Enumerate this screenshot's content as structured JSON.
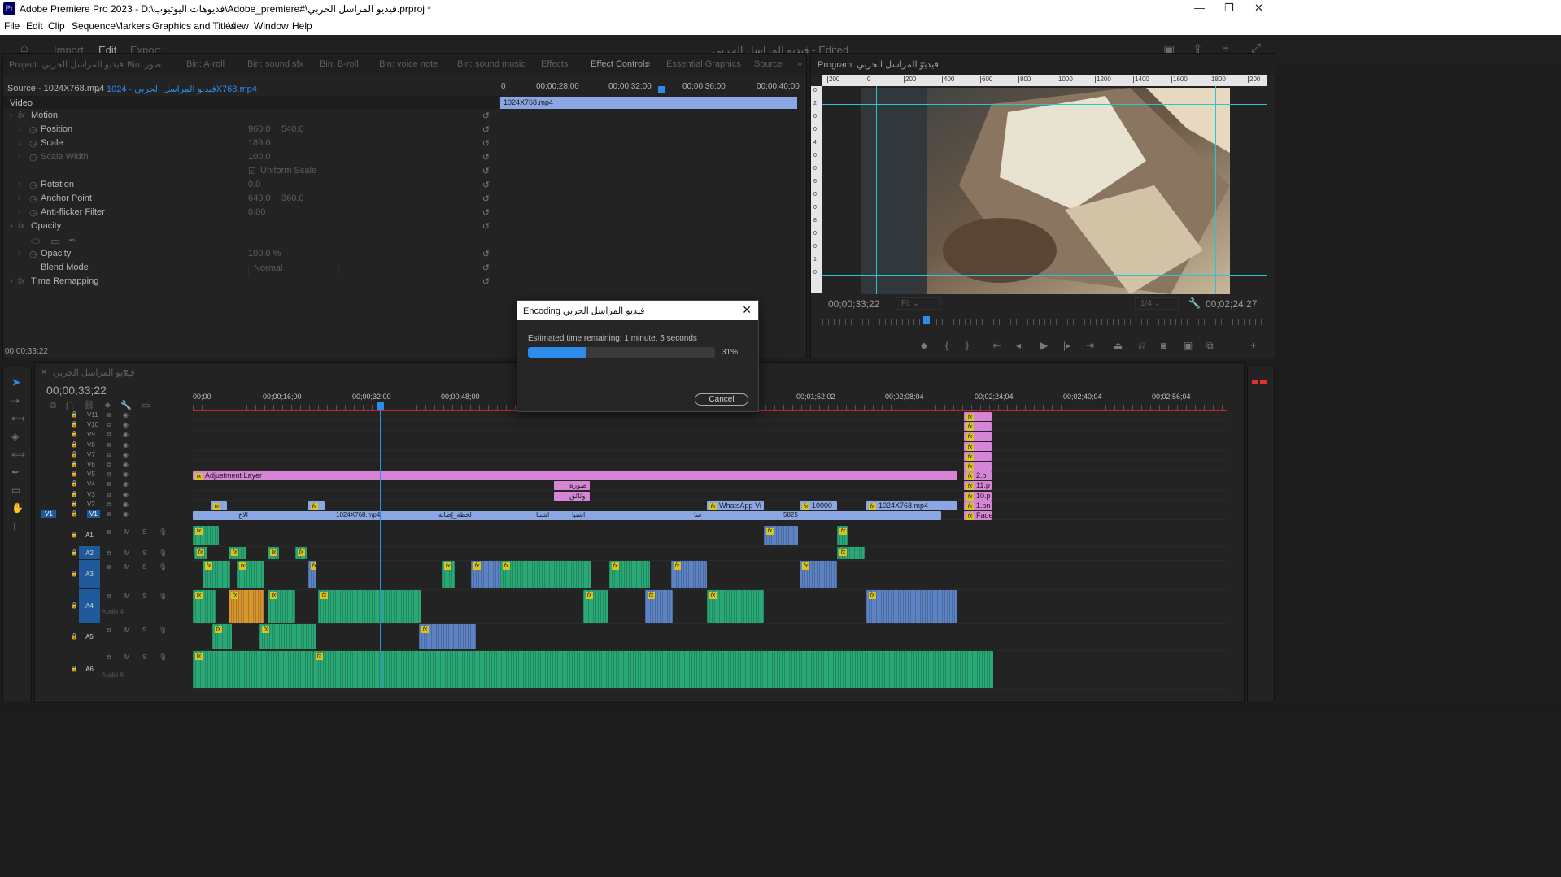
{
  "titlebar": {
    "title": "Adobe Premiere Pro 2023 - D:\\فديوهات اليوتيوب\\Adobe_premiere#\\فيديو المراسل الحربي.prproj *",
    "min": "—",
    "max": "❐",
    "close": "✕"
  },
  "menu": [
    "File",
    "Edit",
    "Clip",
    "Sequence",
    "Markers",
    "Graphics and Titles",
    "View",
    "Window",
    "Help"
  ],
  "workspace": {
    "tabs": [
      "Import",
      "Edit",
      "Export"
    ],
    "active": "Edit",
    "title": "فيديو المراسل الحربي - Edited"
  },
  "source_tabs": [
    "Project: فيديو المراسل الحربي",
    "Bin: صور",
    "Bin: A-roll",
    "Bin: sound sfx",
    "Bin: B-roll",
    "Bin: voice note",
    "Bin: sound music",
    "Effects",
    "Effect Controls",
    "Essential Graphics",
    "Source"
  ],
  "effect_controls": {
    "source": "Source - 1024X768.mp4",
    "sequence": "فيديو المراسل الحربي - 1024X768.mp4",
    "ruler": [
      "0",
      "00;00;28;00",
      "00;00;32;00",
      "00;00;36;00",
      "00;00;40;00"
    ],
    "clip_name": "1024X768.mp4",
    "video": "Video",
    "rows": [
      {
        "label": "Motion",
        "v1": "",
        "v2": "",
        "kind": "group"
      },
      {
        "label": "Position",
        "v1": "960.0",
        "v2": "540.0",
        "kind": "prop"
      },
      {
        "label": "Scale",
        "v1": "189.0",
        "v2": "",
        "kind": "prop"
      },
      {
        "label": "Scale Width",
        "v1": "100.0",
        "v2": "",
        "kind": "dim"
      },
      {
        "label": "",
        "v1": "Uniform Scale",
        "v2": "",
        "kind": "check"
      },
      {
        "label": "Rotation",
        "v1": "0.0",
        "v2": "",
        "kind": "prop"
      },
      {
        "label": "Anchor Point",
        "v1": "640.0",
        "v2": "360.0",
        "kind": "prop"
      },
      {
        "label": "Anti-flicker Filter",
        "v1": "0.00",
        "v2": "",
        "kind": "prop"
      },
      {
        "label": "Opacity",
        "v1": "",
        "v2": "",
        "kind": "group"
      },
      {
        "label": "",
        "v1": "",
        "v2": "",
        "kind": "masks"
      },
      {
        "label": "Opacity",
        "v1": "100.0 %",
        "v2": "",
        "kind": "prop"
      },
      {
        "label": "Blend Mode",
        "v1": "Normal",
        "v2": "",
        "kind": "select"
      },
      {
        "label": "Time Remapping",
        "v1": "",
        "v2": "",
        "kind": "group"
      }
    ],
    "timecode": "00;00;33;22"
  },
  "program": {
    "tab": "Program: فيديو المراسل الحربي",
    "ruler": [
      "200",
      "0",
      "200",
      "400",
      "600",
      "800",
      "1000",
      "1200",
      "1400",
      "1600",
      "1800",
      "200"
    ],
    "vruler": [
      "0",
      "2",
      "0",
      "0",
      "4",
      "0",
      "0",
      "6",
      "0",
      "0",
      "8",
      "0",
      "0",
      "1",
      "0"
    ],
    "timecode": "00;00;33;22",
    "fit": "Fit",
    "quality": "1/4",
    "duration": "00;02;24;27"
  },
  "timeline": {
    "tab": "فيديو المراسل الحربي",
    "timecode": "00;00;33;22",
    "ruler": [
      "00;00",
      "00;00;16;00",
      "00;00;32;00",
      "00;00;48;00",
      "00;01;52;02",
      "00;02;08;04",
      "00;02;24;04",
      "00;02;40;04",
      "00;02;56;04"
    ],
    "video_tracks": [
      "V11",
      "V10",
      "V9",
      "V8",
      "V7",
      "V6",
      "V5",
      "V4",
      "V3",
      "V2",
      "V1"
    ],
    "audio_tracks": [
      "A1",
      "A2",
      "A3",
      "A4",
      "A5",
      "A6"
    ],
    "audio_names": {
      "A4": "Audio 4",
      "A6": "Audio 6"
    },
    "clip_labels": {
      "adjust": "Adjustment Layer",
      "v4": "صورة",
      "v3": "وثائق",
      "v2a": "WhatsApp Vi",
      "v2b": "10000",
      "v2c": "1024X768.mp4",
      "v1main": "1024X768.mp4",
      "v1a": "الاخ",
      "v1b": "لحظة_إصابة",
      "v1c": "اشتبا",
      "v1d": "اشتبا",
      "v1e": "سا",
      "v1f": "5825",
      "pink": [
        "2.p",
        "11.p",
        "10.p",
        "1.pn",
        "Fade"
      ]
    }
  },
  "dialog": {
    "title": "Encoding فيديو المراسل الحربي",
    "message": "Estimated time remaining: 1 minute, 5 seconds",
    "progress": 0.31,
    "percent": "31%",
    "cancel": "Cancel"
  },
  "colors": {
    "accent": "#2d8ceb",
    "adjust": "#d685d6",
    "video": "#8aa6e3",
    "audio": "#2aa876"
  }
}
